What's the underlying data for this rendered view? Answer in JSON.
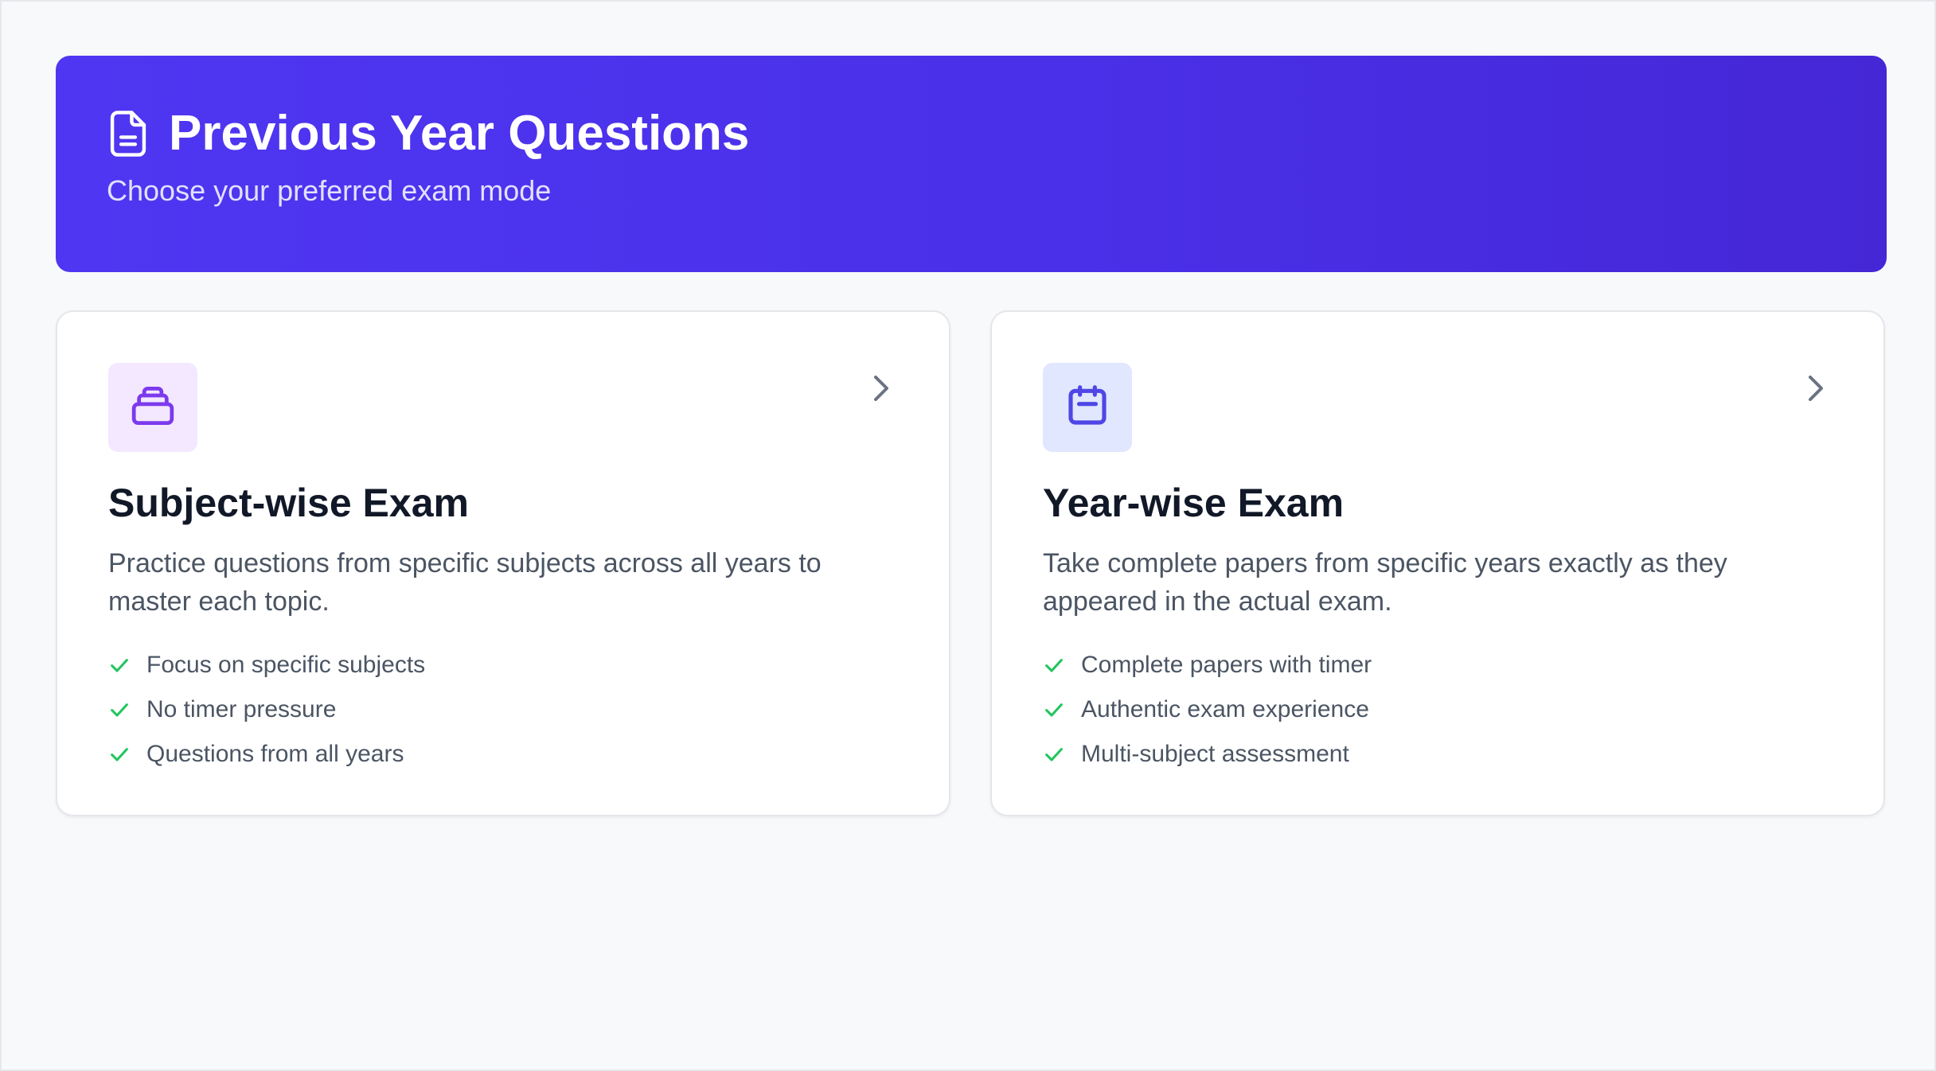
{
  "header": {
    "title": "Previous Year Questions",
    "subtitle": "Choose your preferred exam mode",
    "icon": "document-icon"
  },
  "cards": [
    {
      "icon": "archive-box-icon",
      "title": "Subject-wise Exam",
      "description": "Practice questions from specific subjects across all years to master each topic.",
      "features": [
        "Focus on specific subjects",
        "No timer pressure",
        "Questions from all years"
      ]
    },
    {
      "icon": "calendar-icon",
      "title": "Year-wise Exam",
      "description": "Take complete papers from specific years exactly as they appeared in the actual exam.",
      "features": [
        "Complete papers with timer",
        "Authentic exam experience",
        "Multi-subject assessment"
      ]
    }
  ],
  "colors": {
    "header_gradient_start": "#4f36f2",
    "header_gradient_end": "#4527d6",
    "check_green": "#22c55e",
    "subject_icon_color": "#7c3aed",
    "subject_tile_bg": "#f3e8ff",
    "year_icon_color": "#4f46e5",
    "year_tile_bg": "#e0e7ff"
  }
}
